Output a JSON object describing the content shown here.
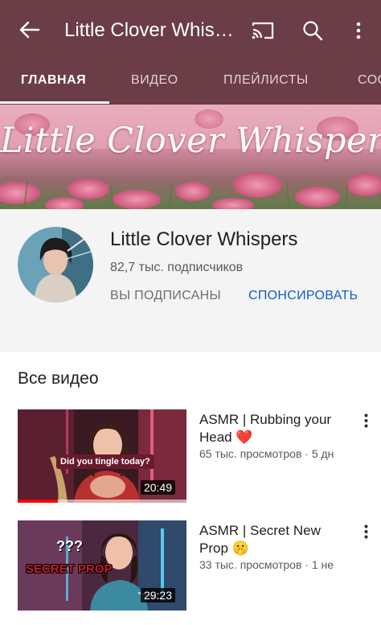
{
  "appbar": {
    "title": "Little Clover Whispers",
    "icons": [
      "back-arrow-icon",
      "cast-icon",
      "search-icon",
      "more-vert-icon"
    ]
  },
  "tabs": [
    {
      "label": "ГЛАВНАЯ",
      "active": true
    },
    {
      "label": "ВИДЕО",
      "active": false
    },
    {
      "label": "ПЛЕЙЛИСТЫ",
      "active": false
    },
    {
      "label": "СООБЩЕСТВО",
      "active": false
    }
  ],
  "banner": {
    "text": "Little Clover Whispers"
  },
  "channel": {
    "name": "Little Clover Whispers",
    "subscribers": "82,7 тыс. подписчиков",
    "subscribed_label": "ВЫ ПОДПИСАНЫ",
    "sponsor_label": "СПОНСИРОВАТЬ"
  },
  "section": {
    "title": "Все видео"
  },
  "videos": [
    {
      "title": "ASMR | Rubbing your Head ❤️",
      "meta": "65 тыс. просмотров · 5 дн",
      "duration": "20:49",
      "watched_fraction": 0.24,
      "thumb_caption": "Did you tingle today?"
    },
    {
      "title": "ASMR | Secret New Prop 🤫",
      "meta": "33 тыс. просмотров · 1 не",
      "duration": "29:23",
      "thumb_caption": "SECRET PROP",
      "thumb_marks": "???"
    }
  ],
  "colors": {
    "appbar": "#6b3d46",
    "accent_link": "#0d5ec7",
    "progress": "#ff0000"
  }
}
